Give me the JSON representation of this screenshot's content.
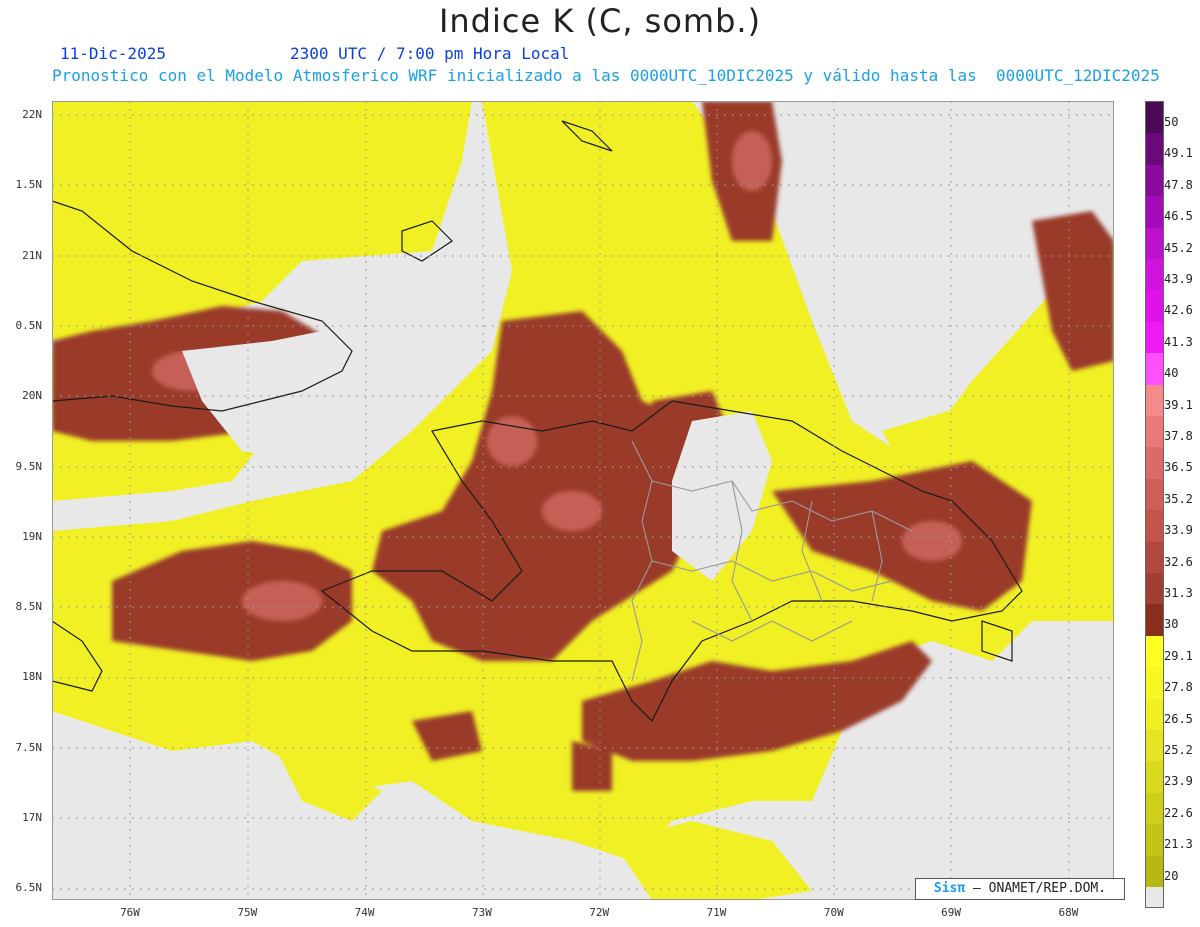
{
  "header": {
    "title": "Indice K (C, somb.)",
    "date": "11-Dic-2025",
    "time": "2300 UTC / 7:00 pm Hora Local",
    "description": "Pronostico con el Modelo Atmosferico WRF inicializado a las 0000UTC_10DIC2025 y válido hasta las  0000UTC_12DIC2025"
  },
  "axes": {
    "y_labels": [
      "22N",
      "1.5N",
      "21N",
      "0.5N",
      "20N",
      "9.5N",
      "19N",
      "8.5N",
      "18N",
      "7.5N",
      "17N",
      "6.5N"
    ],
    "x_labels": [
      "76W",
      "75W",
      "74W",
      "73W",
      "72W",
      "71W",
      "70W",
      "69W",
      "68W"
    ]
  },
  "colorbar": {
    "labels": [
      "50",
      "49.1",
      "47.8",
      "46.5",
      "45.2",
      "43.9",
      "42.6",
      "41.3",
      "40",
      "39.1",
      "37.8",
      "36.5",
      "35.2",
      "33.9",
      "32.6",
      "31.3",
      "30",
      "29.1",
      "27.8",
      "26.5",
      "25.2",
      "23.9",
      "22.6",
      "21.3",
      "20"
    ],
    "colors": [
      "#4a0a55",
      "#6a0a7a",
      "#8a0a9e",
      "#a40ab8",
      "#bd10cc",
      "#d012dd",
      "#e012ea",
      "#f018f5",
      "#ff4fff",
      "#f58a8a",
      "#ea7a78",
      "#dd6a66",
      "#d05e58",
      "#c2544c",
      "#b24840",
      "#a13e34",
      "#8a2e1c",
      "#ffff24",
      "#f7f724",
      "#efef24",
      "#e4e420",
      "#d9d91d",
      "#cfcf1a",
      "#c4c417",
      "#b8b812"
    ],
    "background_color": "#e8e8e8"
  },
  "credit": {
    "brand": "Sisπ",
    "text": " – ONAMET/REP.DOM."
  }
}
